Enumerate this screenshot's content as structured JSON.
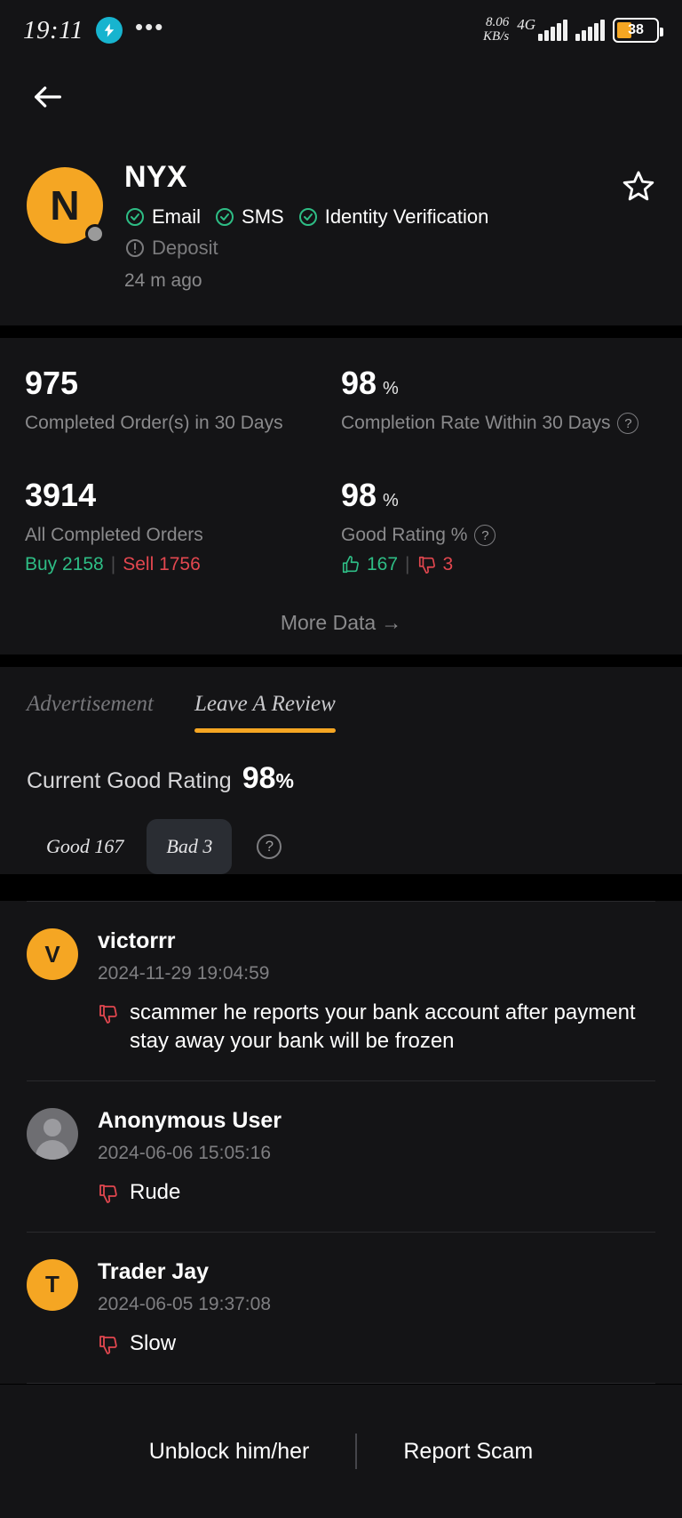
{
  "status_bar": {
    "time": "19:11",
    "bolt_icon": "lightning-badge-icon",
    "menu_dots": "•••",
    "net_speed_value": "8.06",
    "net_speed_unit": "KB/s",
    "network_type": "4G",
    "battery_level": "38"
  },
  "nav": {
    "back_icon": "back-arrow-icon"
  },
  "profile": {
    "avatar_initial": "N",
    "name": "NYX",
    "badges": [
      {
        "label": "Email",
        "verified": true
      },
      {
        "label": "SMS",
        "verified": true
      },
      {
        "label": "Identity Verification",
        "verified": true
      },
      {
        "label": "Deposit",
        "verified": false
      }
    ],
    "last_seen": "24 m ago",
    "favorite_icon": "star-outline-icon"
  },
  "stats": {
    "items": [
      {
        "value": "975",
        "unit": "",
        "label": "Completed Order(s) in 30 Days",
        "help": false
      },
      {
        "value": "98",
        "unit": "%",
        "label": "Completion Rate Within 30 Days",
        "help": true
      },
      {
        "value": "3914",
        "unit": "",
        "label": "All Completed Orders",
        "help": false
      },
      {
        "value": "98",
        "unit": "%",
        "label": "Good Rating %",
        "help": true
      }
    ],
    "buy_label": "Buy 2158",
    "sell_label": "Sell 1756",
    "separator": "|",
    "thumbs_up_count": "167",
    "thumbs_down_count": "3",
    "more_data": "More Data",
    "more_data_arrow": "→"
  },
  "tabs": [
    {
      "label": "Advertisement",
      "active": false
    },
    {
      "label": "Leave A Review",
      "active": true
    }
  ],
  "rating": {
    "current_label": "Current Good Rating",
    "current_value": "98",
    "percent_sign": "%",
    "chips": [
      {
        "label": "Good 167",
        "selected": false
      },
      {
        "label": "Bad 3",
        "selected": true
      }
    ],
    "help_icon": "question-mark-icon"
  },
  "reviews": [
    {
      "avatar_initial": "V",
      "avatar_type": "initial",
      "name": "victorrr",
      "date": "2024-11-29 19:04:59",
      "sentiment": "down",
      "text": "scammer he reports your bank account after payment stay away your bank will be frozen"
    },
    {
      "avatar_initial": "",
      "avatar_type": "anonymous",
      "name": "Anonymous User",
      "date": "2024-06-06 15:05:16",
      "sentiment": "down",
      "text": "Rude"
    },
    {
      "avatar_initial": "T",
      "avatar_type": "initial",
      "name": "Trader Jay",
      "date": "2024-06-05 19:37:08",
      "sentiment": "down",
      "text": "Slow"
    }
  ],
  "footer": {
    "unblock_label": "Unblock him/her",
    "report_label": "Report Scam"
  },
  "colors": {
    "accent": "#f5a623",
    "good": "#2ebd85",
    "bad": "#e2474f",
    "surface": "#141416",
    "background": "#000000"
  }
}
